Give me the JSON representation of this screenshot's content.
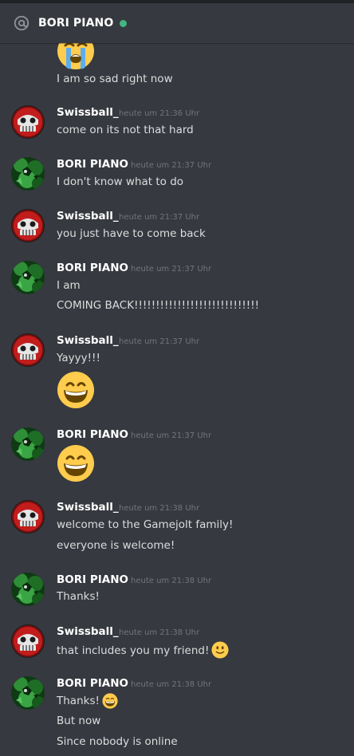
{
  "channel": {
    "title": "BORI PIANO",
    "status_color": "#43b581",
    "header_icon": "at-sign-icon"
  },
  "users": {
    "swissball": {
      "name": "Swissball_",
      "avatar": "red-robot-avatar"
    },
    "bori": {
      "name": "BORI PIANO",
      "avatar": "green-creature-avatar"
    }
  },
  "messages": [
    {
      "text": "I am so sad right now",
      "emoji": "loudly-crying-face-emoji"
    },
    {
      "author": "Swissball_",
      "time": "heute um 21:36 Uhr",
      "lines": [
        "come on its not that hard"
      ]
    },
    {
      "author": "BORI PIANO",
      "time": "heute um 21:37 Uhr",
      "lines": [
        "I don't know what to do"
      ]
    },
    {
      "author": "Swissball_",
      "time": "heute um 21:37 Uhr",
      "lines": [
        "you just have to come back"
      ]
    },
    {
      "author": "BORI PIANO",
      "time": "heute um 21:37 Uhr",
      "lines": [
        "I am",
        "COMING BACK!!!!!!!!!!!!!!!!!!!!!!!!!!!!!"
      ]
    },
    {
      "author": "Swissball_",
      "time": "heute um 21:37 Uhr",
      "lines": [
        "Yayyy!!!"
      ],
      "emoji": "grinning-face-emoji"
    },
    {
      "author": "BORI PIANO",
      "time": "heute um 21:37 Uhr",
      "emoji": "grinning-face-emoji"
    },
    {
      "author": "Swissball_",
      "time": "heute um 21:38 Uhr",
      "lines": [
        "welcome to the Gamejolt family!",
        "everyone is welcome!"
      ]
    },
    {
      "author": "BORI PIANO",
      "time": "heute um 21:38 Uhr",
      "lines": [
        "Thanks!"
      ]
    },
    {
      "author": "Swissball_",
      "time": "heute um 21:38 Uhr",
      "lines": [
        "that includes you my friend!"
      ],
      "emoji": "slightly-smiling-face-emoji"
    },
    {
      "author": "BORI PIANO",
      "time": "heute um 21:38 Uhr",
      "lines": [
        "Thanks!",
        "But now",
        "Since nobody is online"
      ],
      "emoji": "grinning-face-emoji"
    }
  ]
}
